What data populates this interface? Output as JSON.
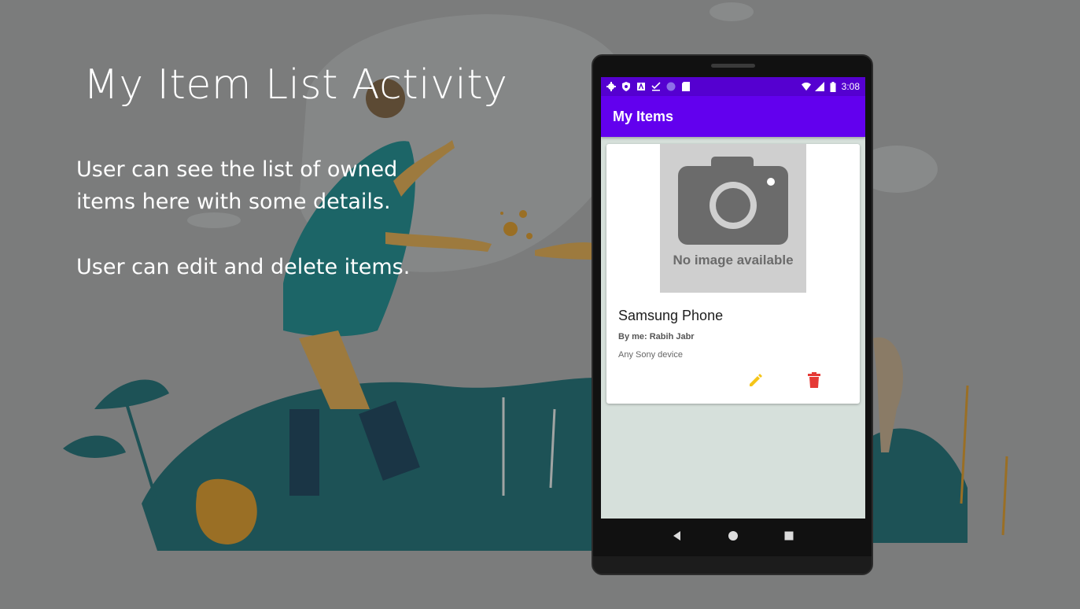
{
  "slide": {
    "title": "My Item List Activity",
    "line1": "User can see the list of owned",
    "line2": "items here with some details.",
    "line3": "User can edit and delete items."
  },
  "status_bar": {
    "time": "3:08",
    "icons": [
      "gear-icon",
      "shield-icon",
      "font-icon",
      "check-icon",
      "circle-icon",
      "sd-card-icon",
      "wifi-icon",
      "signal-icon",
      "battery-icon"
    ]
  },
  "app_bar": {
    "title": "My Items",
    "color": "#6200ee"
  },
  "items": [
    {
      "image_placeholder": "No image available",
      "name": "Samsung Phone",
      "owner": "By me: Rabih Jabr",
      "description": "Any Sony device",
      "edit_icon_color": "#f5c518",
      "delete_icon_color": "#e53935"
    }
  ],
  "nav_bar": {
    "icons": [
      "back-icon",
      "home-icon",
      "recents-icon"
    ]
  }
}
